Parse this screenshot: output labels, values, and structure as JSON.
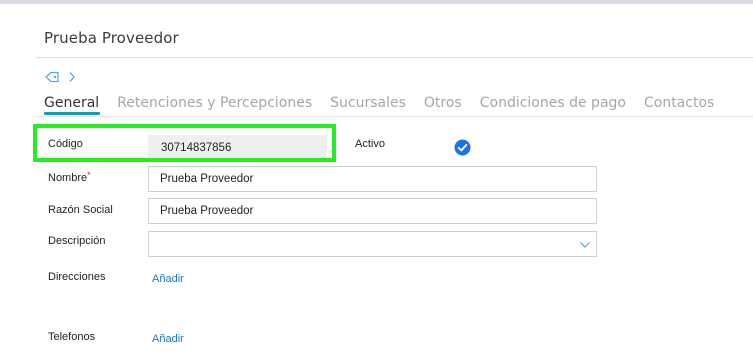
{
  "header": {
    "title": "Prueba Proveedor"
  },
  "tabs": [
    {
      "label": "General",
      "active": true
    },
    {
      "label": "Retenciones y Percepciones",
      "active": false
    },
    {
      "label": "Sucursales",
      "active": false
    },
    {
      "label": "Otros",
      "active": false
    },
    {
      "label": "Condiciones de pago",
      "active": false
    },
    {
      "label": "Contactos",
      "active": false
    }
  ],
  "form": {
    "codigo": {
      "label": "Código",
      "value": "30714837856"
    },
    "activo": {
      "label": "Activo",
      "checked": true
    },
    "nombre": {
      "label": "Nombre",
      "required_mark": "*",
      "value": "Prueba Proveedor"
    },
    "razon_social": {
      "label": "Razón Social",
      "value": "Prueba Proveedor"
    },
    "descripcion": {
      "label": "Descripción",
      "value": ""
    },
    "direcciones": {
      "label": "Direcciones",
      "action": "Añadir"
    },
    "telefonos": {
      "label": "Telefonos",
      "action": "Añadir"
    }
  },
  "colors": {
    "accent": "#1a9bb4",
    "highlight": "#22ee22",
    "link": "#1a78c2",
    "check": "#1a73e8"
  },
  "icons": [
    "tag-icon",
    "chevron-right-icon",
    "check-circle-icon",
    "chevron-down-icon"
  ]
}
